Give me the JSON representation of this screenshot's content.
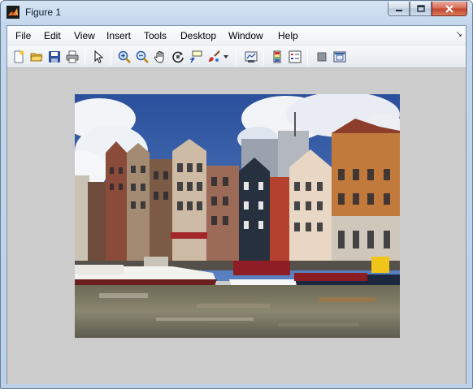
{
  "window": {
    "title": "Figure 1",
    "controls": [
      "minimize-icon",
      "maximize-icon",
      "close-icon"
    ]
  },
  "menubar": {
    "items": [
      "File",
      "Edit",
      "View",
      "Insert",
      "Tools",
      "Desktop",
      "Window",
      "Help"
    ],
    "dock_arrow": "↘"
  },
  "toolbar": {
    "buttons": [
      "new-figure-icon",
      "open-file-icon",
      "save-figure-icon",
      "print-figure-icon",
      "edit-plot-icon",
      "zoom-in-icon",
      "zoom-out-icon",
      "pan-icon",
      "rotate-3d-icon",
      "data-cursor-icon",
      "brush-icon",
      "link-plot-icon",
      "insert-colorbar-icon",
      "insert-legend-icon",
      "hide-plot-tools-icon",
      "show-plot-tools-icon"
    ]
  },
  "figure": {
    "background": "#cccccc",
    "image": "Amsterdam canal houses photo"
  },
  "colors": {
    "title_gradient_top": "#d5e4f3",
    "close_button": "#c2432a",
    "figure_background": "#cccccc"
  }
}
